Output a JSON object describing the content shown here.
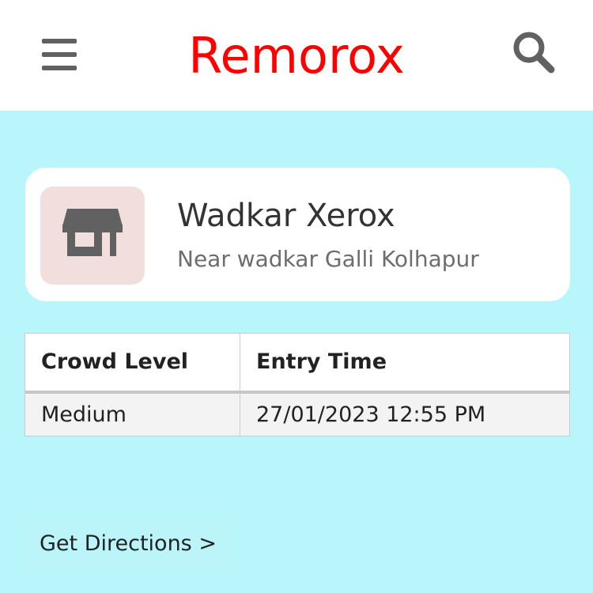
{
  "header": {
    "title": "Remorox",
    "menu_icon": "hamburger-menu-icon",
    "search_icon": "search-icon"
  },
  "store": {
    "icon": "store-icon",
    "name": "Wadkar Xerox",
    "address": "Near wadkar Galli Kolhapur"
  },
  "table": {
    "headers": [
      "Crowd Level",
      "Entry Time"
    ],
    "rows": [
      [
        "Medium",
        "27/01/2023 12:55 PM"
      ]
    ]
  },
  "actions": {
    "directions_label": "Get Directions >"
  },
  "colors": {
    "brand": "#ff0000",
    "background": "#b9f6fb",
    "icon_tile": "#f3dede",
    "icon": "#616161"
  }
}
